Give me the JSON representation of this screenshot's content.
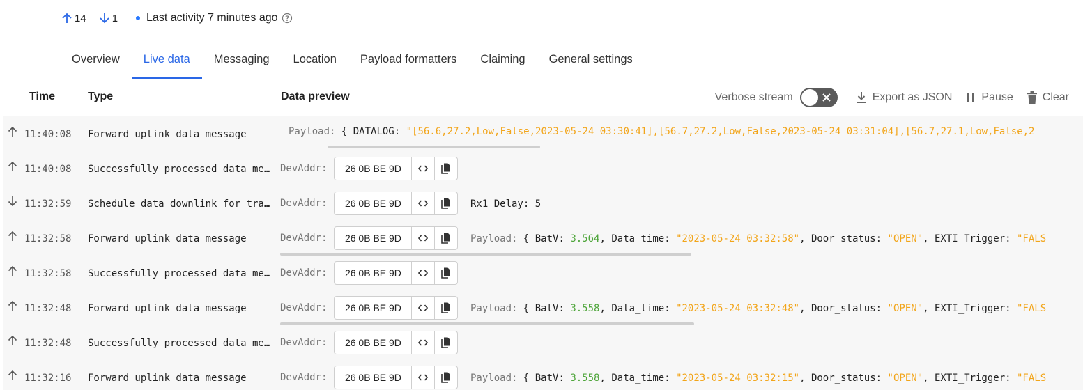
{
  "stats": {
    "uplink_count": "14",
    "downlink_count": "1",
    "activity": "Last activity 7 minutes ago",
    "uplink_icon": "arrow-up-icon",
    "downlink_icon": "arrow-down-icon",
    "status_color": "#2979ff"
  },
  "tabs": [
    {
      "label": "Overview",
      "active": false
    },
    {
      "label": "Live data",
      "active": true
    },
    {
      "label": "Messaging",
      "active": false
    },
    {
      "label": "Location",
      "active": false
    },
    {
      "label": "Payload formatters",
      "active": false
    },
    {
      "label": "Claiming",
      "active": false
    },
    {
      "label": "General settings",
      "active": false
    }
  ],
  "table": {
    "headers": {
      "time": "Time",
      "type": "Type",
      "preview": "Data preview"
    },
    "controls": {
      "verbose": "Verbose stream",
      "export": "Export as JSON",
      "pause": "Pause",
      "clear": "Clear"
    },
    "devaddr_label": "DevAddr:",
    "payload_label": "Payload:",
    "rows": [
      {
        "dir": "up",
        "time": "11:40:08",
        "type": "Forward uplink data message",
        "payload_full": {
          "brace": "{ DATALOG:",
          "value": "\"[56.6,27.2,Low,False,2023-05-24 03:30:41],[56.7,27.2,Low,False,2023-05-24 03:31:04],[56.7,27.1,Low,False,2"
        }
      },
      {
        "dir": "up",
        "time": "11:40:08",
        "type": "Successfully processed data message",
        "devaddr": "26 0B BE 9D"
      },
      {
        "dir": "down",
        "time": "11:32:59",
        "type": "Schedule data downlink for transmission",
        "devaddr": "26 0B BE 9D",
        "extra": "Rx1 Delay: 5"
      },
      {
        "dir": "up",
        "time": "11:32:58",
        "type": "Forward uplink data message",
        "devaddr": "26 0B BE 9D",
        "payload": {
          "brace": "{ BatV:",
          "batv": "3.564",
          "k2": ", Data_time:",
          "data_time": "\"2023-05-24 03:32:58\"",
          "k3": ", Door_status:",
          "door": "\"OPEN\"",
          "k4": ", EXTI_Trigger:",
          "trigger": "\"FALS"
        }
      },
      {
        "dir": "up",
        "time": "11:32:58",
        "type": "Successfully processed data message",
        "devaddr": "26 0B BE 9D"
      },
      {
        "dir": "up",
        "time": "11:32:48",
        "type": "Forward uplink data message",
        "devaddr": "26 0B BE 9D",
        "payload": {
          "brace": "{ BatV:",
          "batv": "3.558",
          "k2": ", Data_time:",
          "data_time": "\"2023-05-24 03:32:48\"",
          "k3": ", Door_status:",
          "door": "\"OPEN\"",
          "k4": ", EXTI_Trigger:",
          "trigger": "\"FALS"
        }
      },
      {
        "dir": "up",
        "time": "11:32:48",
        "type": "Successfully processed data message",
        "devaddr": "26 0B BE 9D"
      },
      {
        "dir": "up",
        "time": "11:32:16",
        "type": "Forward uplink data message",
        "devaddr": "26 0B BE 9D",
        "payload": {
          "brace": "{ BatV:",
          "batv": "3.558",
          "k2": ", Data_time:",
          "data_time": "\"2023-05-24 03:32:15\"",
          "k3": ", Door_status:",
          "door": "\"OPEN\"",
          "k4": ", EXTI_Trigger:",
          "trigger": "\"FALS"
        }
      }
    ]
  }
}
